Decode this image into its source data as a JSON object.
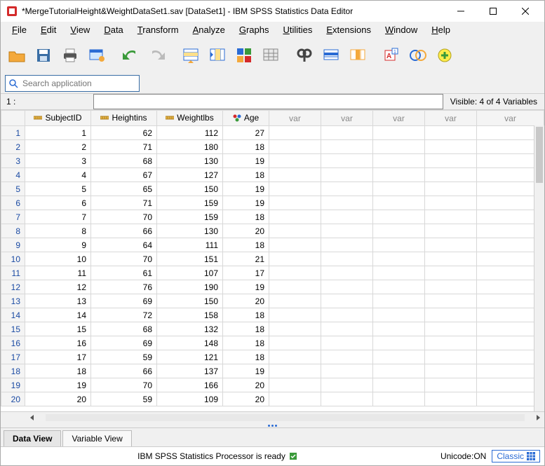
{
  "window": {
    "title": "*MergeTutorialHeight&WeightDataSet1.sav [DataSet1] - IBM SPSS Statistics Data Editor"
  },
  "menu": {
    "items": [
      "File",
      "Edit",
      "View",
      "Data",
      "Transform",
      "Analyze",
      "Graphs",
      "Utilities",
      "Extensions",
      "Window",
      "Help"
    ]
  },
  "search": {
    "placeholder": "Search application"
  },
  "info": {
    "cellref": "1 :",
    "visible": "Visible: 4 of 4 Variables"
  },
  "columns": {
    "c1": "SubjectID",
    "c2": "Heightins",
    "c3": "Weightlbs",
    "c4": "Age",
    "var": "var"
  },
  "rows": [
    {
      "n": "1",
      "id": "1",
      "h": "62",
      "w": "112",
      "a": "27"
    },
    {
      "n": "2",
      "id": "2",
      "h": "71",
      "w": "180",
      "a": "18"
    },
    {
      "n": "3",
      "id": "3",
      "h": "68",
      "w": "130",
      "a": "19"
    },
    {
      "n": "4",
      "id": "4",
      "h": "67",
      "w": "127",
      "a": "18"
    },
    {
      "n": "5",
      "id": "5",
      "h": "65",
      "w": "150",
      "a": "19"
    },
    {
      "n": "6",
      "id": "6",
      "h": "71",
      "w": "159",
      "a": "19"
    },
    {
      "n": "7",
      "id": "7",
      "h": "70",
      "w": "159",
      "a": "18"
    },
    {
      "n": "8",
      "id": "8",
      "h": "66",
      "w": "130",
      "a": "20"
    },
    {
      "n": "9",
      "id": "9",
      "h": "64",
      "w": "111",
      "a": "18"
    },
    {
      "n": "10",
      "id": "10",
      "h": "70",
      "w": "151",
      "a": "21"
    },
    {
      "n": "11",
      "id": "11",
      "h": "61",
      "w": "107",
      "a": "17"
    },
    {
      "n": "12",
      "id": "12",
      "h": "76",
      "w": "190",
      "a": "19"
    },
    {
      "n": "13",
      "id": "13",
      "h": "69",
      "w": "150",
      "a": "20"
    },
    {
      "n": "14",
      "id": "14",
      "h": "72",
      "w": "158",
      "a": "18"
    },
    {
      "n": "15",
      "id": "15",
      "h": "68",
      "w": "132",
      "a": "18"
    },
    {
      "n": "16",
      "id": "16",
      "h": "69",
      "w": "148",
      "a": "18"
    },
    {
      "n": "17",
      "id": "17",
      "h": "59",
      "w": "121",
      "a": "18"
    },
    {
      "n": "18",
      "id": "18",
      "h": "66",
      "w": "137",
      "a": "19"
    },
    {
      "n": "19",
      "id": "19",
      "h": "70",
      "w": "166",
      "a": "20"
    },
    {
      "n": "20",
      "id": "20",
      "h": "59",
      "w": "109",
      "a": "20"
    }
  ],
  "tabs": {
    "data": "Data View",
    "variable": "Variable View"
  },
  "status": {
    "processor": "IBM SPSS Statistics Processor is ready",
    "unicode": "Unicode:ON",
    "mode": "Classic"
  },
  "icons": {
    "toolbar": [
      "open-icon",
      "save-icon",
      "print-icon",
      "recall-dialog-icon",
      "undo-icon",
      "redo-icon",
      "goto-case-icon",
      "goto-variable-icon",
      "variables-icon",
      "run-descriptives-icon",
      "find-icon",
      "insert-cases-icon",
      "insert-variable-icon",
      "split-file-icon",
      "weight-cases-icon",
      "value-labels-icon"
    ]
  }
}
